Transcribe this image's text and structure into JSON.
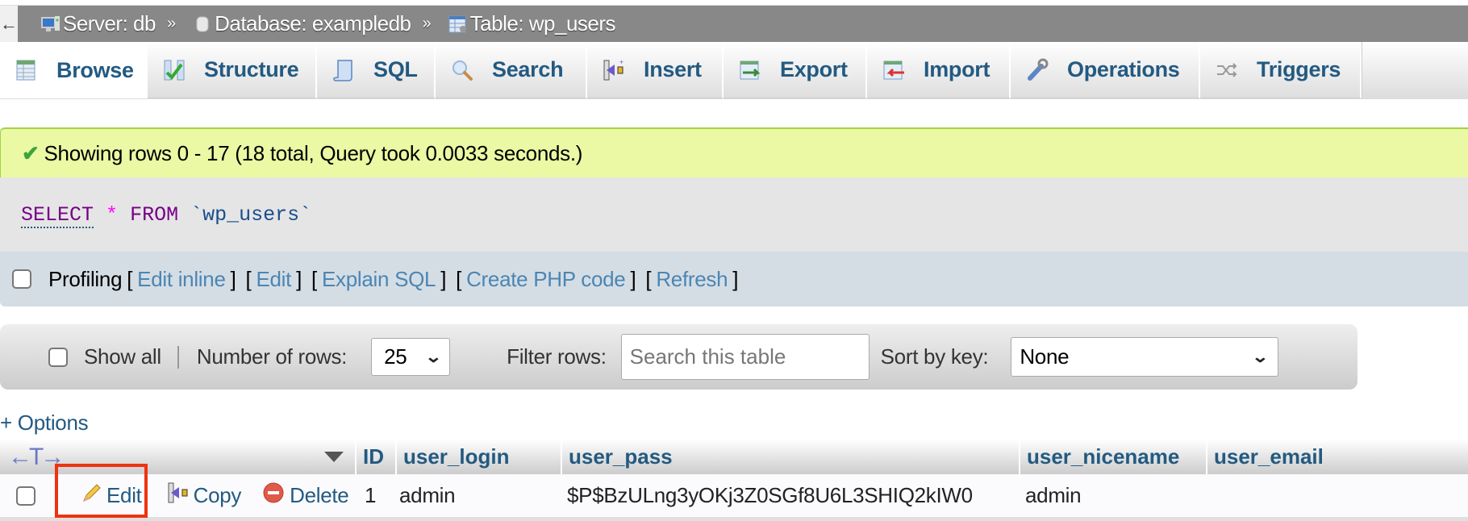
{
  "breadcrumb": {
    "back_icon": "arrow-left-icon",
    "items": [
      {
        "label": "Server: db",
        "icon": "server-icon"
      },
      {
        "label": "Database: exampledb",
        "icon": "database-icon"
      },
      {
        "label": "Table: wp_users",
        "icon": "table-icon"
      }
    ],
    "separator": "»"
  },
  "tabs": [
    {
      "label": "Browse",
      "icon": "browse-icon",
      "active": true
    },
    {
      "label": "Structure",
      "icon": "structure-icon"
    },
    {
      "label": "SQL",
      "icon": "sql-icon"
    },
    {
      "label": "Search",
      "icon": "search-icon"
    },
    {
      "label": "Insert",
      "icon": "insert-icon"
    },
    {
      "label": "Export",
      "icon": "export-icon"
    },
    {
      "label": "Import",
      "icon": "import-icon"
    },
    {
      "label": "Operations",
      "icon": "operations-icon"
    },
    {
      "label": "Triggers",
      "icon": "triggers-icon"
    }
  ],
  "notice": {
    "icon": "check-icon",
    "text": "Showing rows 0 - 17 (18 total, Query took 0.0033 seconds.)"
  },
  "sql": {
    "select": "SELECT",
    "star": "*",
    "from": "FROM",
    "table": "`wp_users`"
  },
  "profiling": {
    "label": "Profiling",
    "checked": false,
    "links": [
      "Edit inline",
      "Edit",
      "Explain SQL",
      "Create PHP code",
      "Refresh"
    ]
  },
  "navigation": {
    "show_all_label": "Show all",
    "show_all_checked": false,
    "rows_label": "Number of rows:",
    "rows_value": "25",
    "filter_label": "Filter rows:",
    "filter_placeholder": "Search this table",
    "filter_value": "",
    "sort_label": "Sort by key:",
    "sort_value": "None"
  },
  "options_link": "+ Options",
  "table": {
    "columns": [
      "ID",
      "user_login",
      "user_pass",
      "user_nicename",
      "user_email"
    ],
    "rows": [
      {
        "actions": {
          "edit": "Edit",
          "copy": "Copy",
          "delete": "Delete"
        },
        "cells": [
          "1",
          "admin",
          "$P$BzULng3yOKj3Z0SGf8U6L3SHIQ2kIW0",
          "admin",
          ""
        ]
      }
    ]
  },
  "colors": {
    "accent": "#235a81",
    "link": "#4a86b4",
    "notice_bg": "#ebf8a4",
    "highlight_box": "#ee3311"
  }
}
